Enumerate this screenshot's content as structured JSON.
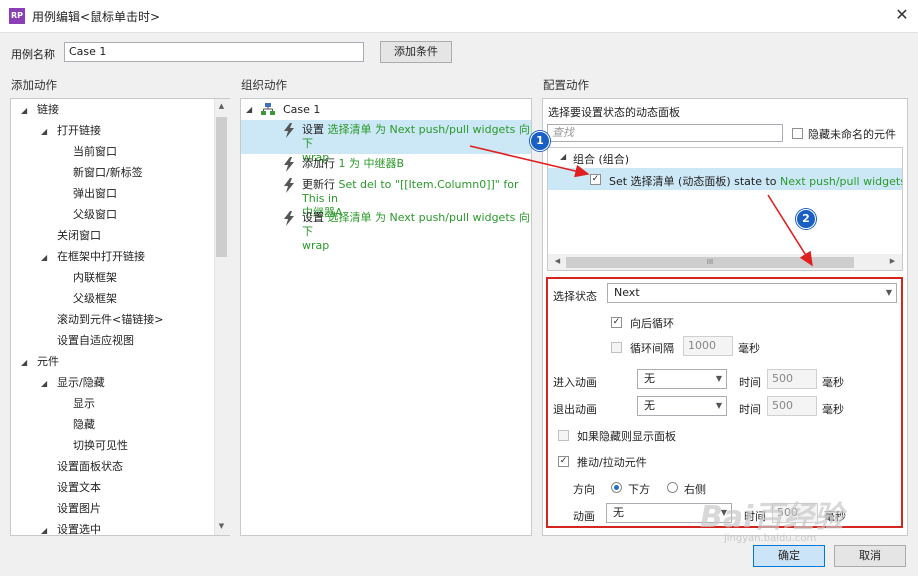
{
  "window": {
    "title": "用例编辑<鼠标单击时>",
    "app_icon_text": "RP",
    "close_glyph": "✕"
  },
  "case_name": {
    "label": "用例名称",
    "value": "Case 1",
    "add_condition": "添加条件"
  },
  "left": {
    "heading": "添加动作",
    "items": [
      {
        "text": "链接",
        "level": 0,
        "expand": true
      },
      {
        "text": "打开链接",
        "level": 1,
        "expand": true
      },
      {
        "text": "当前窗口",
        "level": 2
      },
      {
        "text": "新窗口/新标签",
        "level": 2
      },
      {
        "text": "弹出窗口",
        "level": 2
      },
      {
        "text": "父级窗口",
        "level": 2
      },
      {
        "text": "关闭窗口",
        "level": 1
      },
      {
        "text": "在框架中打开链接",
        "level": 1,
        "expand": true
      },
      {
        "text": "内联框架",
        "level": 2
      },
      {
        "text": "父级框架",
        "level": 2
      },
      {
        "text": "滚动到元件<锚链接>",
        "level": 1
      },
      {
        "text": "设置自适应视图",
        "level": 1
      },
      {
        "text": "元件",
        "level": 0,
        "expand": true
      },
      {
        "text": "显示/隐藏",
        "level": 1,
        "expand": true
      },
      {
        "text": "显示",
        "level": 2
      },
      {
        "text": "隐藏",
        "level": 2
      },
      {
        "text": "切换可见性",
        "level": 2
      },
      {
        "text": "设置面板状态",
        "level": 1
      },
      {
        "text": "设置文本",
        "level": 1
      },
      {
        "text": "设置图片",
        "level": 1
      },
      {
        "text": "设置选中",
        "level": 1,
        "expand": true
      }
    ]
  },
  "middle": {
    "heading": "组织动作",
    "case_label": "Case 1",
    "actions": [
      {
        "line1_prefix": "设置 ",
        "line1_green": "选择清单 为 Next push/pull widgets 向下",
        "line2_green": "wrap",
        "selected": true
      },
      {
        "line1_prefix": "添加行 ",
        "line1_green": "1 为 中继器B",
        "line2_green": "",
        "selected": false
      },
      {
        "line1_prefix": "更新行 ",
        "line1_green": "Set del to \"[[Item.Column0]]\" for This in",
        "line2_green": "中继器A",
        "selected": false
      },
      {
        "line1_prefix": "设置 ",
        "line1_green": "选择清单 为 Next push/pull widgets 向下",
        "line2_green": "wrap",
        "selected": false
      }
    ]
  },
  "right": {
    "heading": "配置动作",
    "panel_title": "选择要设置状态的动态面板",
    "search_placeholder": "查找",
    "hide_unnamed": "隐藏未命名的元件",
    "group_label": "组合 (组合)",
    "item_prefix": "Set 选择清单 (动态面板) state to ",
    "item_green": "Next push/pull widgets 向下",
    "item_checked": "✓",
    "hscroll_glyph": "III",
    "select_state_label": "选择状态",
    "select_state_value": "Next",
    "wrap_label": "向后循环",
    "wrap_checked": "✓",
    "loop_interval_label": "循环间隔",
    "loop_interval_value": "1000",
    "ms": "毫秒",
    "enter_anim_label": "进入动画",
    "enter_anim_value": "无",
    "exit_anim_label": "退出动画",
    "exit_anim_value": "无",
    "time_label": "时间",
    "enter_time": "500",
    "exit_time": "500",
    "show_if_hidden": "如果隐藏则显示面板",
    "push_pull": "推动/拉动元件",
    "push_checked": "✓",
    "direction_label": "方向",
    "dir_down": "下方",
    "dir_right": "右侧",
    "anim_label": "动画",
    "anim_value": "无",
    "bottom_time_value": "500",
    "bottom_ms_partial": "毫秒"
  },
  "footer": {
    "ok": "确定",
    "cancel": "取消"
  },
  "annotations": {
    "badge1": "1",
    "badge2": "2",
    "highlight_color": "#d4261f",
    "arrow_color": "#e02020"
  },
  "watermark": {
    "text": "Bai百经验",
    "sub": "jingyan.baidu.com"
  },
  "colors": {
    "accent_green": "#2a9a2a",
    "selection": "#cce8f6",
    "primary_btn": "#cce4f7"
  }
}
